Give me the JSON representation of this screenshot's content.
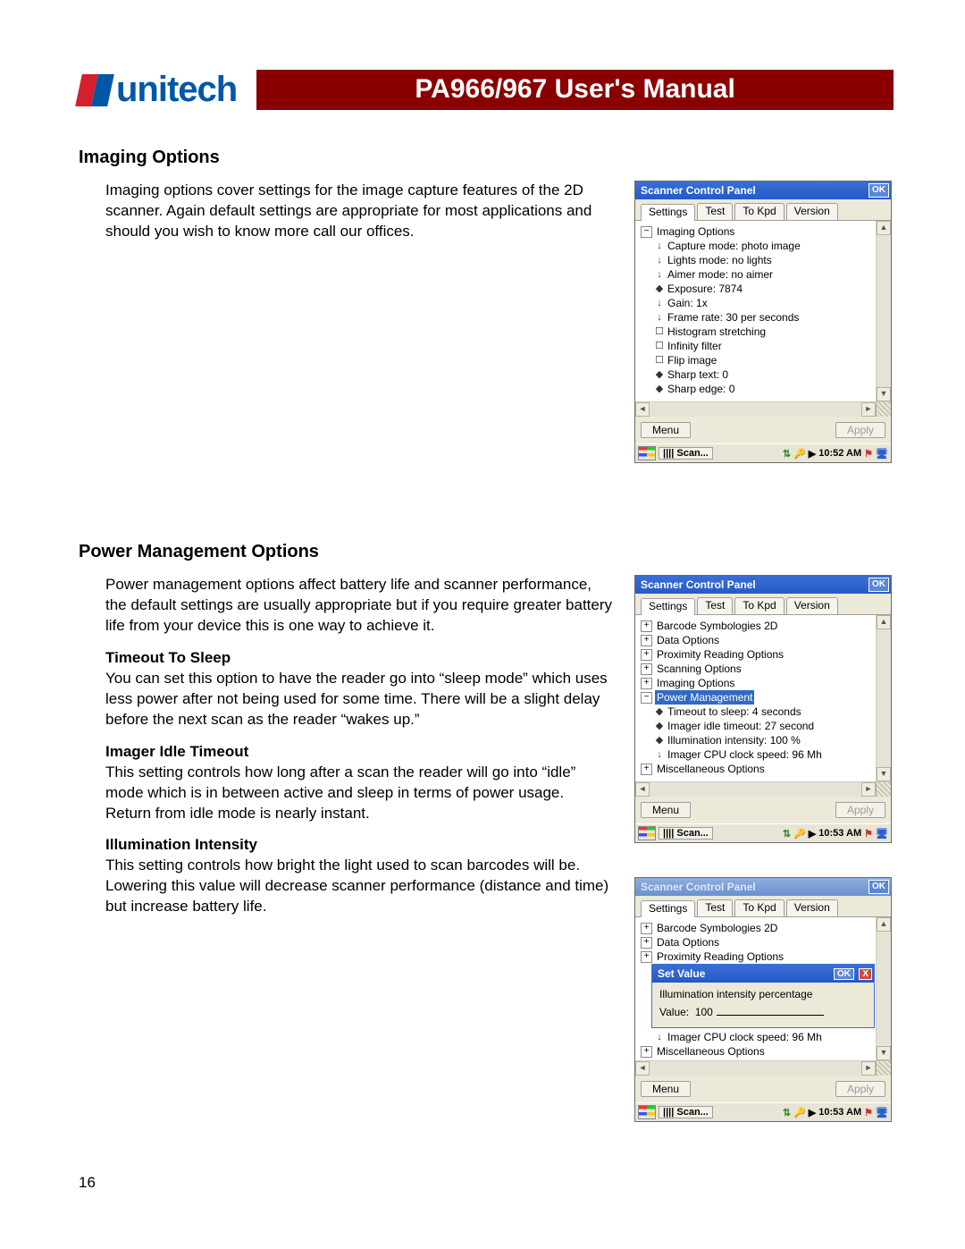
{
  "header": {
    "logo_text": "unitech",
    "title": "PA966/967 User's Manual"
  },
  "page_number": "16",
  "section_imaging": {
    "heading": "Imaging Options",
    "body": "Imaging options cover settings for the image capture features of the 2D scanner. Again default settings are appropriate for most applications and should you wish to know more call our offices."
  },
  "section_power": {
    "heading": "Power Management Options",
    "intro": "Power management options affect battery life and scanner performance, the default settings are usually appropriate but if you require greater battery life from your device this is one way to achieve it.",
    "sub1_h": "Timeout To Sleep",
    "sub1_p": "You can set this option to have the reader go into “sleep mode” which uses less power after not being used for some time. There will be a slight delay before the next scan as the reader “wakes up.”",
    "sub2_h": "Imager Idle Timeout",
    "sub2_p": "This setting controls how long after a scan the reader will go into “idle” mode which is in between active and sleep in terms of power usage. Return from idle mode is nearly instant.",
    "sub3_h": "Illumination Intensity",
    "sub3_p": "This setting controls how bright the light used to scan barcodes will be. Lowering this value will decrease scanner performance (distance and time) but increase battery life."
  },
  "dlg_common": {
    "title": "Scanner Control Panel",
    "ok": "OK",
    "x": "X",
    "tabs": {
      "settings": "Settings",
      "test": "Test",
      "tokpd": "To Kpd",
      "version": "Version"
    },
    "menu": "Menu",
    "apply": "Apply",
    "task_label": "Scan...",
    "time1": "10:52 AM",
    "time2": "10:53 AM"
  },
  "tree1": {
    "root": "Imaging Options",
    "items": [
      "Capture mode: photo image",
      "Lights mode: no lights",
      "Aimer mode: no aimer",
      "Exposure: 7874",
      "Gain: 1x",
      "Frame rate: 30 per seconds",
      "Histogram stretching",
      "Infinity filter",
      "Flip image",
      "Sharp text: 0",
      "Sharp edge: 0"
    ]
  },
  "tree2": {
    "n0": "Barcode Symbologies 2D",
    "n1": "Data Options",
    "n2": "Proximity Reading Options",
    "n3": "Scanning Options",
    "n4": "Imaging Options",
    "sel": "Power Management",
    "c0": "Timeout to sleep: 4 seconds",
    "c1": "Imager idle timeout: 27 second",
    "c2": "Illumination intensity: 100 %",
    "c3": "Imager CPU clock speed: 96 Mh",
    "n5": "Miscellaneous Options"
  },
  "tree3": {
    "n0": "Barcode Symbologies 2D",
    "n1": "Data Options",
    "n2": "Proximity Reading Options",
    "c3": "Imager CPU clock speed: 96 Mh",
    "n5": "Miscellaneous Options"
  },
  "setval": {
    "title": "Set Value",
    "label": "Illumination intensity percentage",
    "value_prefix": "Value:",
    "value": "100"
  }
}
